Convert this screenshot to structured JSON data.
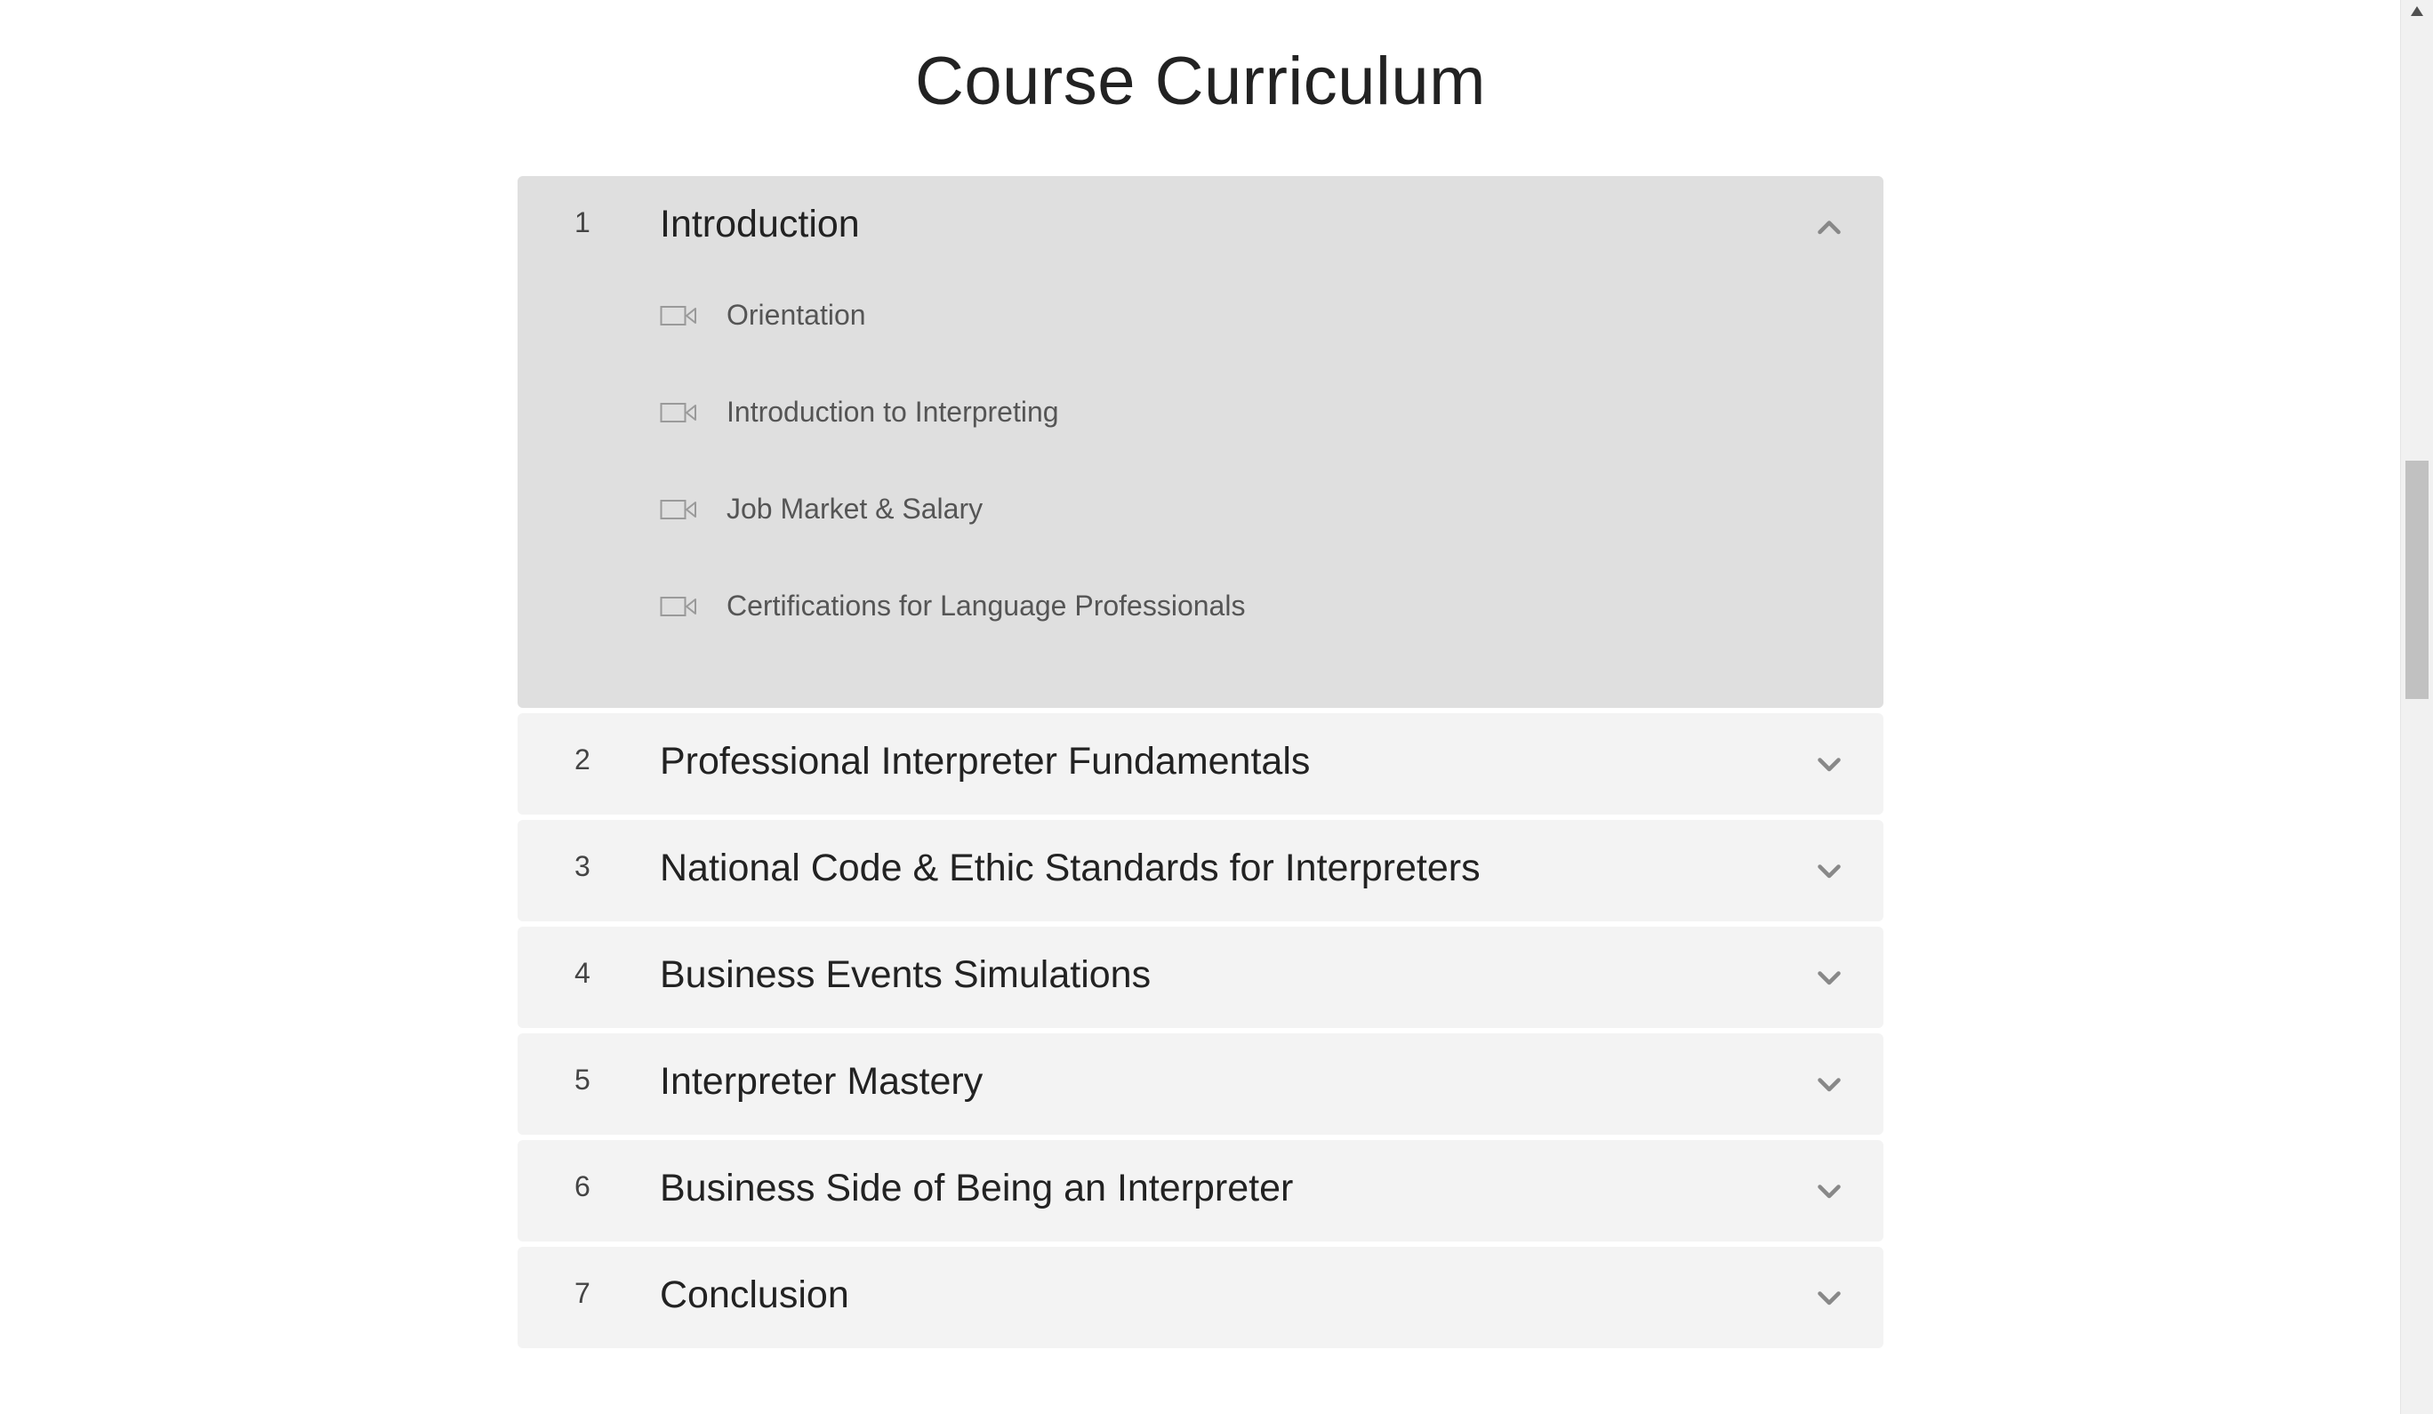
{
  "page": {
    "title": "Course Curriculum"
  },
  "curriculum": {
    "sections": [
      {
        "number": "1",
        "title": "Introduction",
        "expanded": true,
        "lessons": [
          {
            "label": "Orientation",
            "icon": "video-camera-icon"
          },
          {
            "label": "Introduction to Interpreting",
            "icon": "video-camera-icon"
          },
          {
            "label": "Job Market & Salary",
            "icon": "video-camera-icon"
          },
          {
            "label": "Certifications for Language Professionals",
            "icon": "video-camera-icon"
          }
        ]
      },
      {
        "number": "2",
        "title": "Professional Interpreter Fundamentals",
        "expanded": false
      },
      {
        "number": "3",
        "title": "National Code & Ethic Standards for Interpreters",
        "expanded": false
      },
      {
        "number": "4",
        "title": "Business Events Simulations",
        "expanded": false
      },
      {
        "number": "5",
        "title": "Interpreter Mastery",
        "expanded": false
      },
      {
        "number": "6",
        "title": "Business Side of Being an Interpreter",
        "expanded": false
      },
      {
        "number": "7",
        "title": "Conclusion",
        "expanded": false
      }
    ]
  },
  "colors": {
    "expanded_bg": "#dfdfdf",
    "collapsed_bg": "#f3f3f3",
    "chevron": "#888888",
    "icon": "#9a9a9a"
  }
}
